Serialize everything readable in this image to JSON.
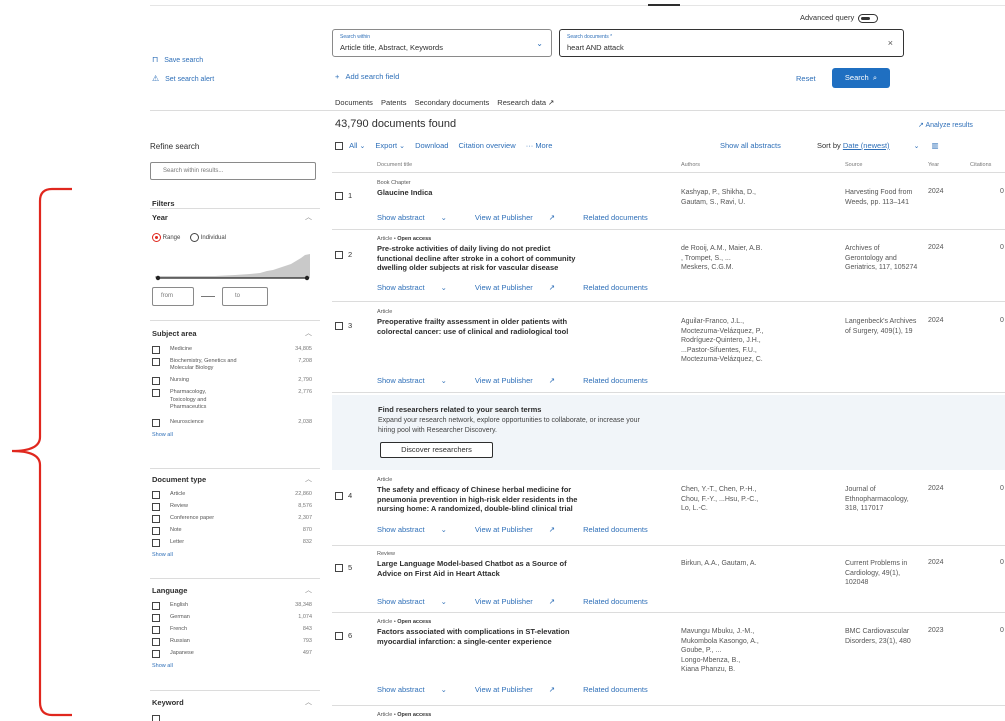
{
  "top": {
    "advanced_query_label": "Advanced query"
  },
  "search": {
    "within_label": "Search within",
    "within_value": "Article title, Abstract, Keywords",
    "documents_label": "Search documents *",
    "documents_value": "heart AND attack",
    "add_field": "Add search field",
    "reset": "Reset",
    "search_button": "Search"
  },
  "left_actions": {
    "save_search": "Save search",
    "set_alert": "Set search alert"
  },
  "tabs": [
    "Documents",
    "Patents",
    "Secondary documents",
    "Research data"
  ],
  "results": {
    "count": "43,790 documents found",
    "analyze": "Analyze results",
    "toolbar": {
      "all": "All",
      "export": "Export",
      "download": "Download",
      "citation_overview": "Citation overview",
      "more": "More",
      "show_all_abstracts": "Show all abstracts",
      "sort_by": "Sort by",
      "sort_value": "Date (newest)"
    },
    "columns": {
      "title": "Document title",
      "authors": "Authors",
      "source": "Source",
      "year": "Year",
      "citations": "Citations"
    },
    "link_show_abstract": "Show abstract",
    "link_view_publisher": "View at Publisher",
    "link_related": "Related documents",
    "items": [
      {
        "num": "1",
        "type": "Book Chapter",
        "open_access": "",
        "title_lines": [
          "Glaucine Indica"
        ],
        "author_lines": [
          "Kashyap, P., Shikha, D.,",
          "Gautam, S., Ravi, U."
        ],
        "source_lines": [
          "Harvesting Food from",
          "Weeds, pp. 113–141"
        ],
        "year": "2024",
        "citations": "0"
      },
      {
        "num": "2",
        "type": "Article",
        "open_access": "Open access",
        "title_lines": [
          "Pre-stroke activities of daily living do not predict",
          "functional decline after stroke in a cohort of community",
          "dwelling older subjects at risk for vascular disease"
        ],
        "author_lines": [
          "de Rooij, A.M., Maier, A.B.",
          ", Trompet, S., ...",
          "Meskers, C.G.M."
        ],
        "source_lines": [
          "Archives of",
          "Gerontology and",
          "Geriatrics, 117, 105274"
        ],
        "year": "2024",
        "citations": "0"
      },
      {
        "num": "3",
        "type": "Article",
        "open_access": "",
        "title_lines": [
          "Preoperative frailty assessment in older patients with",
          "colorectal cancer: use of clinical and radiological tool"
        ],
        "author_lines": [
          "Aguilar-Franco, J.L.,",
          "Moctezuma-Velázquez, P.,",
          "Rodríguez-Quintero, J.H.,",
          "...Pastor-Sifuentes, F.U.,",
          "Moctezuma-Velázquez, C."
        ],
        "source_lines": [
          "Langenbeck's Archives",
          "of Surgery, 409(1), 19"
        ],
        "year": "2024",
        "citations": "0"
      },
      {
        "num": "4",
        "type": "Article",
        "open_access": "",
        "title_lines": [
          "The safety and efficacy of Chinese herbal medicine for",
          "pneumonia prevention in high-risk elder residents in the",
          "nursing home: A randomized, double-blind clinical trial"
        ],
        "author_lines": [
          "Chen, Y.-T., Chen, P.-H.,",
          "Chou, F.-Y., ...Hsu, P.-C.,",
          "Lo, L.-C."
        ],
        "source_lines": [
          "Journal of",
          "Ethnopharmacology,",
          "318, 117017"
        ],
        "year": "2024",
        "citations": "0"
      },
      {
        "num": "5",
        "type": "Review",
        "open_access": "",
        "title_lines": [
          "Large Language Model-based Chatbot as a Source of",
          "Advice on First Aid in Heart Attack"
        ],
        "author_lines": [
          "Birkun, A.A., Gautam, A."
        ],
        "source_lines": [
          "Current Problems in",
          "Cardiology, 49(1),",
          "102048"
        ],
        "year": "2024",
        "citations": "0"
      },
      {
        "num": "6",
        "type": "Article",
        "open_access": "Open access",
        "title_lines": [
          "Factors associated with complications in ST-elevation",
          "myocardial infarction: a single-center experience"
        ],
        "author_lines": [
          "Mavungu Mbuku, J.-M.,",
          "Mukombola Kasongo, A.,",
          "Goube, P., ...",
          "Longo-Mbenza, B.,",
          "Kiana Phanzu, B."
        ],
        "source_lines": [
          "BMC Cardiovascular",
          "Disorders, 23(1), 480"
        ],
        "year": "2023",
        "citations": "0"
      }
    ],
    "next_item_type": "Article",
    "next_item_open_access": "Open access"
  },
  "promo": {
    "title": "Find researchers related to your search terms",
    "text_line1": "Expand your research network, explore opportunities to collaborate, or increase your",
    "text_line2": "hiring pool with Researcher Discovery.",
    "button": "Discover researchers"
  },
  "sidebar": {
    "refine": "Refine search",
    "search_placeholder": "Search within results...",
    "filters": "Filters",
    "year": {
      "title": "Year",
      "range": "Range",
      "individual": "Individual",
      "from": "from",
      "to": "to"
    },
    "subject_area": {
      "title": "Subject area",
      "items": [
        {
          "name": "Medicine",
          "count": "34,805"
        },
        {
          "name": "Biochemistry, Genetics and Molecular Biology",
          "count": "7,208"
        },
        {
          "name": "Nursing",
          "count": "2,790"
        },
        {
          "name": "Pharmacology, Toxicology and Pharmaceutics",
          "count": "2,776"
        },
        {
          "name": "Neuroscience",
          "count": "2,038"
        }
      ],
      "show_all": "Show all"
    },
    "document_type": {
      "title": "Document type",
      "items": [
        {
          "name": "Article",
          "count": "22,860"
        },
        {
          "name": "Review",
          "count": "8,576"
        },
        {
          "name": "Conference paper",
          "count": "2,307"
        },
        {
          "name": "Note",
          "count": "870"
        },
        {
          "name": "Letter",
          "count": "832"
        }
      ],
      "show_all": "Show all"
    },
    "language": {
      "title": "Language",
      "items": [
        {
          "name": "English",
          "count": "38,348"
        },
        {
          "name": "German",
          "count": "1,074"
        },
        {
          "name": "French",
          "count": "843"
        },
        {
          "name": "Russian",
          "count": "793"
        },
        {
          "name": "Japanese",
          "count": "497"
        }
      ],
      "show_all": "Show all"
    },
    "keyword": {
      "title": "Keyword"
    }
  },
  "colors": {
    "accent": "#1f6fc1",
    "link": "#2e6fb8",
    "bracket": "#e0271e"
  }
}
